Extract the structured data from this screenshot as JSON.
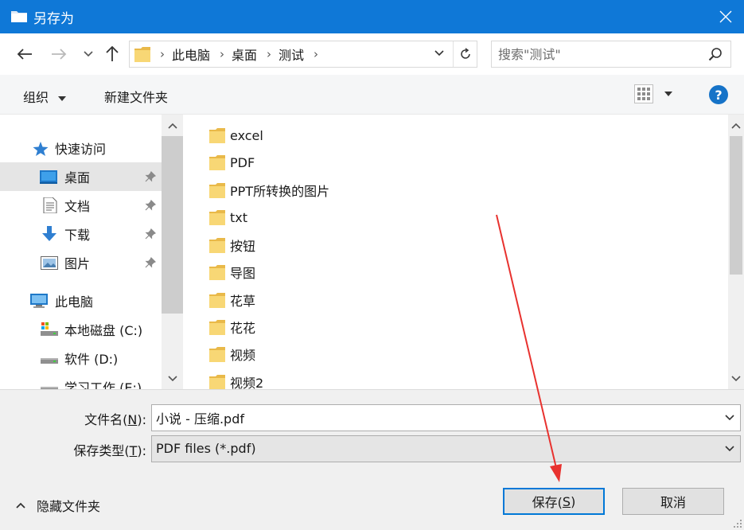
{
  "window": {
    "title": "另存为"
  },
  "nav": {
    "address": {
      "crumbs": [
        "此电脑",
        "桌面",
        "测试"
      ]
    },
    "search": {
      "placeholder": "搜索\"测试\""
    }
  },
  "toolbar": {
    "organize_label": "组织",
    "new_folder_label": "新建文件夹"
  },
  "sidebar": {
    "quick_access_label": "快速访问",
    "items": [
      {
        "label": "桌面",
        "icon": "desktop-icon",
        "pinned": true,
        "selected": true
      },
      {
        "label": "文档",
        "icon": "document-icon",
        "pinned": true
      },
      {
        "label": "下载",
        "icon": "download-icon",
        "pinned": true
      },
      {
        "label": "图片",
        "icon": "pictures-icon",
        "pinned": true
      }
    ],
    "this_pc_label": "此电脑",
    "drives": [
      {
        "label": "本地磁盘 (C:)",
        "icon": "system-drive-icon"
      },
      {
        "label": "软件 (D:)",
        "icon": "drive-icon"
      },
      {
        "label": "学习工作 (E:)",
        "icon": "drive-icon"
      }
    ]
  },
  "files": [
    {
      "name": "excel"
    },
    {
      "name": "PDF"
    },
    {
      "name": "PPT所转换的图片"
    },
    {
      "name": "txt"
    },
    {
      "name": "按钮"
    },
    {
      "name": "导图"
    },
    {
      "name": "花草"
    },
    {
      "name": "花花"
    },
    {
      "name": "视频"
    },
    {
      "name": "视频2"
    }
  ],
  "form": {
    "filename_label_pre": "文件名(",
    "filename_label_key": "N",
    "filename_label_post": "):",
    "filename_value": "小说 - 压缩.pdf",
    "filetype_label_pre": "保存类型(",
    "filetype_label_key": "T",
    "filetype_label_post": "):",
    "filetype_value": "PDF files (*.pdf)"
  },
  "footer": {
    "hide_folders_label": "隐藏文件夹",
    "save_pre": "保存(",
    "save_key": "S",
    "save_post": ")",
    "cancel_label": "取消"
  },
  "colors": {
    "titlebar": "#0f78d7",
    "accent": "#0078d7",
    "annotation_arrow": "#e8322f",
    "folder": "#f8d775"
  }
}
